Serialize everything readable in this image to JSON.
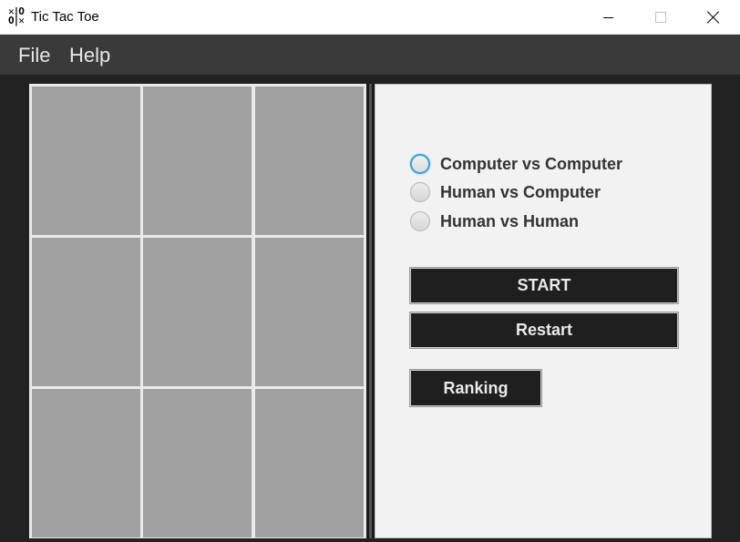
{
  "window": {
    "title": "Tic Tac Toe",
    "icon": "tic-tac-toe-icon",
    "icon_glyph_top": "✕|O",
    "icon_glyph_bottom": "O|✕"
  },
  "menu": {
    "items": [
      "File",
      "Help"
    ]
  },
  "board": {
    "cells": [
      "",
      "",
      "",
      "",
      "",
      "",
      "",
      "",
      ""
    ],
    "cell_color": "#a0a0a0"
  },
  "modes": {
    "options": [
      "Computer vs Computer",
      "Human vs Computer",
      "Human vs Human"
    ],
    "focused_index": 0
  },
  "buttons": {
    "start": "START",
    "restart": "Restart",
    "ranking": "Ranking"
  },
  "colors": {
    "button_bg": "#1f1f1f",
    "focus_ring": "#3a9fd8",
    "menubar_bg": "#3a3a3a"
  }
}
